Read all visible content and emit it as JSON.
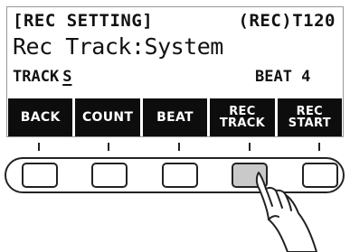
{
  "lcd": {
    "header_left": "[REC SETTING]",
    "header_right": "(REC)T120",
    "main_text": "Rec Track:System",
    "track_label": "TRACK",
    "track_value": "S",
    "beat_label": "BEAT 4"
  },
  "softkeys": [
    {
      "line1": "BACK",
      "line2": ""
    },
    {
      "line1": "COUNT",
      "line2": ""
    },
    {
      "line1": "BEAT",
      "line2": ""
    },
    {
      "line1": "REC",
      "line2": "TRACK"
    },
    {
      "line1": "REC",
      "line2": "START"
    }
  ],
  "hardware": {
    "pressed_button": 4,
    "pressed_color": "#c9c9c9",
    "button_icons": [
      "blank-button",
      "blank-button",
      "blank-button",
      "blank-button",
      "blank-button"
    ],
    "pointer_icon": "pointing-hand-icon"
  },
  "colors": {
    "softkey_bg": "#0d0d0d",
    "softkey_text": "#ffffff",
    "lcd_text": "#111111"
  }
}
